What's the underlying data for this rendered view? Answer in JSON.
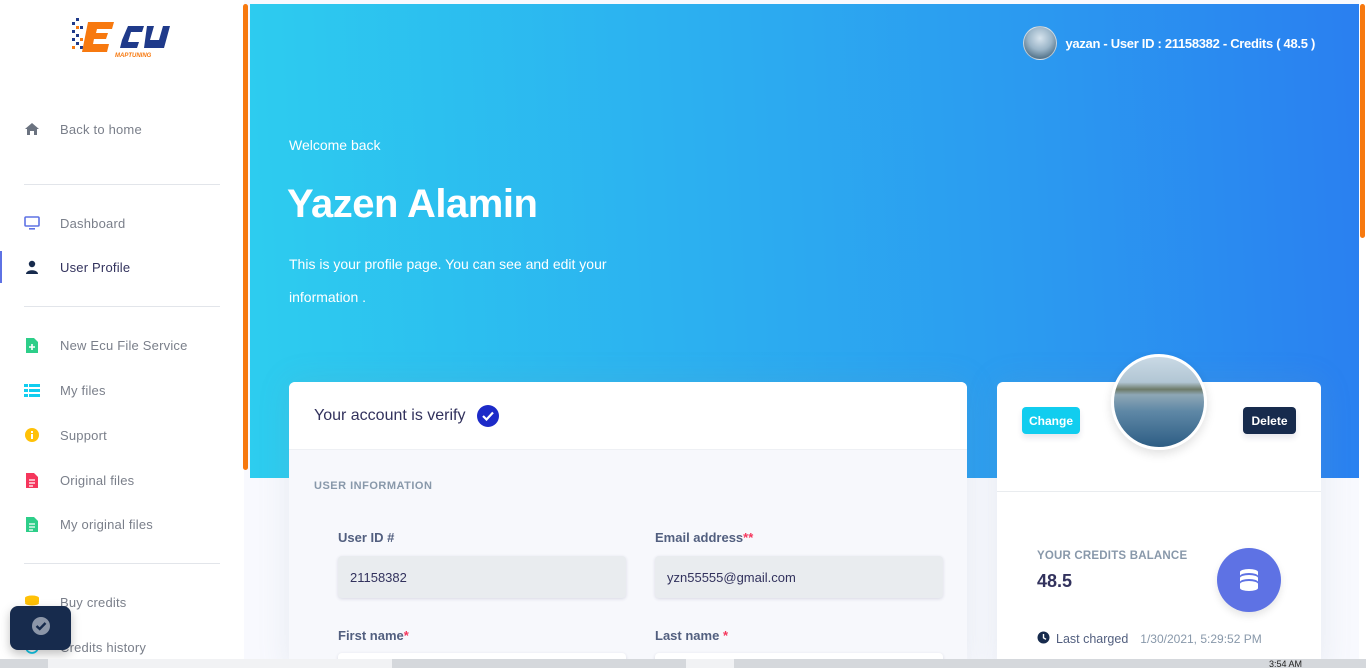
{
  "colors": {
    "accent": "#f7790f",
    "primary": "#5e72e4",
    "hero_start": "#2dcdef",
    "hero_end": "#2a7ff0",
    "dark": "#172b4d",
    "info": "#11cdef"
  },
  "sidebar": {
    "logo_text": "ECU",
    "logo_subtext": "MAPTUNING",
    "items": [
      {
        "label": "Back to home",
        "icon": "home-icon"
      },
      {
        "label": "Dashboard",
        "icon": "monitor-icon"
      },
      {
        "label": "User Profile",
        "icon": "user-icon"
      },
      {
        "label": "New Ecu File Service",
        "icon": "file-plus-icon"
      },
      {
        "label": "My files",
        "icon": "list-icon"
      },
      {
        "label": "Support",
        "icon": "info-icon"
      },
      {
        "label": "Original files",
        "icon": "file-icon"
      },
      {
        "label": "My original files",
        "icon": "file-text-icon"
      },
      {
        "label": "Buy credits",
        "icon": "coins-icon"
      },
      {
        "label": "Credits history",
        "icon": "history-icon"
      }
    ]
  },
  "header": {
    "user_chip": "yazan - User ID : 21158382 - Credits ( 48.5 )",
    "welcome": "Welcome back",
    "name": "Yazen Alamin",
    "description": "This is your profile page. You can see and edit your information ."
  },
  "profile_form": {
    "status": "Your account is verify",
    "section_title": "USER INFORMATION",
    "user_id_label": "User ID #",
    "user_id_value": "21158382",
    "email_label": "Email address",
    "email_required": "**",
    "email_value": "yzn55555@gmail.com",
    "first_name_label": "First name",
    "first_name_required": "*",
    "last_name_label": "Last name",
    "last_name_required": "*"
  },
  "profile_side": {
    "change_label": "Change",
    "delete_label": "Delete",
    "credits_label": "YOUR CREDITS BALANCE",
    "credits_value": "48.5",
    "last_charged_label": "Last charged",
    "last_charged_value": "1/30/2021, 5:29:52 PM"
  },
  "taskbar": {
    "time": "3:54 AM"
  }
}
